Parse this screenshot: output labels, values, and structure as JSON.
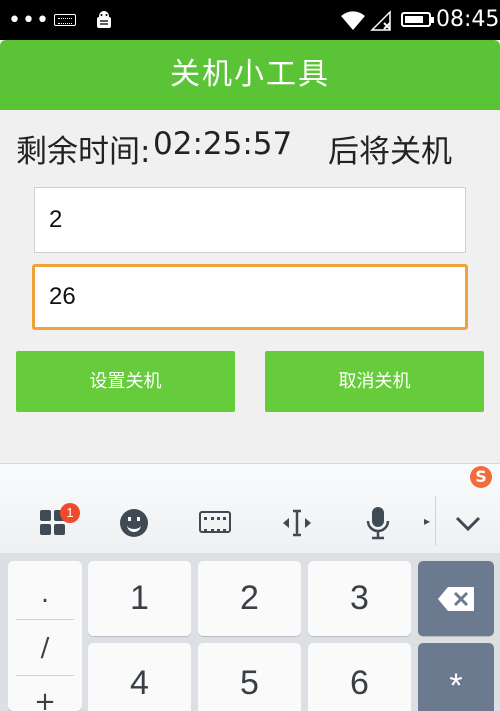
{
  "status_bar": {
    "time": "08:45",
    "icons": [
      "more-dots-icon",
      "keyboard-icon",
      "android-debug-icon",
      "wifi-icon",
      "signal-icon",
      "battery-icon"
    ],
    "battery_level_percent": 80
  },
  "app": {
    "title": "关机小工具",
    "accent_color": "#5bc436"
  },
  "countdown": {
    "label": "剩余时间:",
    "time": "02:25:57",
    "suffix": "后将关机"
  },
  "inputs": {
    "hours_value": "2",
    "minutes_value": "26"
  },
  "buttons": {
    "set_label": "设置关机",
    "cancel_label": "取消关机"
  },
  "keyboard": {
    "logo": "S",
    "badge_count": "1",
    "toolbar_icons": [
      "grid-menu-icon",
      "emoji-icon",
      "keyboard-icon",
      "cursor-move-icon",
      "microphone-icon",
      "collapse-icon"
    ],
    "symbols": [
      ".",
      "/",
      "+"
    ],
    "row1": [
      "1",
      "2",
      "3"
    ],
    "row2": [
      "4",
      "5",
      "6"
    ],
    "backspace_icon": "backspace-icon",
    "row2_extra": "*"
  }
}
